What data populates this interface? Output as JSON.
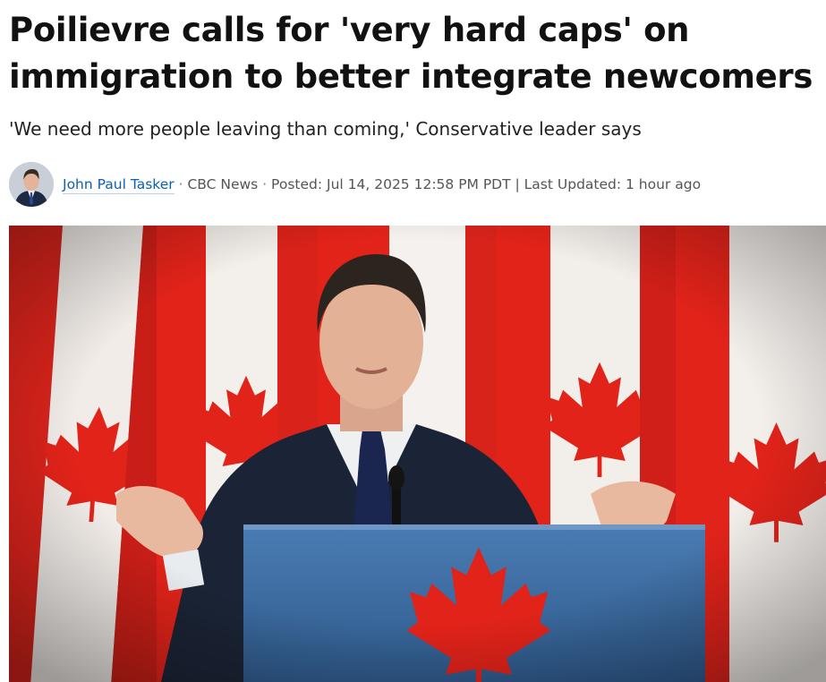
{
  "article": {
    "headline": "Poilievre calls for 'very hard caps' on immigration to better integrate newcomers",
    "dek": "'We need more people leaving than coming,' Conservative leader says",
    "byline": {
      "author": "John Paul Tasker",
      "sep1": " · ",
      "outlet": "CBC News",
      "sep2": " · ",
      "posted_label": "Posted: ",
      "posted_value": "Jul 14, 2025 12:58 PM PDT",
      "divider": " | ",
      "updated_label": "Last Updated: ",
      "updated_value": "1 hour ago"
    }
  },
  "colors": {
    "headline": "#111111",
    "author_link": "#0b5fb4",
    "flag_red": "#e2231a",
    "flag_white": "#f4f1ee",
    "podium_blue": "#3f6fa6"
  },
  "icons": {
    "avatar": "author-avatar-photo"
  }
}
